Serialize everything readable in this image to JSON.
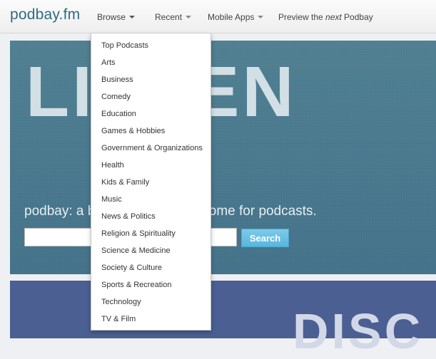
{
  "brand": "podbay.fm",
  "nav": {
    "browse": "Browse",
    "recent": "Recent",
    "mobile": "Mobile Apps",
    "preview_prefix": "Preview the ",
    "preview_emph": "next",
    "preview_suffix": " Podbay"
  },
  "hero": {
    "word": "LISTEN",
    "tagline": "podbay: a beautiful, powerful home for podcasts.",
    "search_value": "",
    "search_button": "Search"
  },
  "hero2": {
    "word": "DISC"
  },
  "dropdown": {
    "items": [
      "Top Podcasts",
      "Arts",
      "Business",
      "Comedy",
      "Education",
      "Games & Hobbies",
      "Government & Organizations",
      "Health",
      "Kids & Family",
      "Music",
      "News & Politics",
      "Religion & Spirituality",
      "Science & Medicine",
      "Society & Culture",
      "Sports & Recreation",
      "Technology",
      "TV & Film"
    ]
  },
  "colors": {
    "brand": "#2f6c80",
    "hero_bg": "#4a7a8c",
    "hero2_bg": "#4b5f93",
    "search_button": "#5bb8de"
  }
}
